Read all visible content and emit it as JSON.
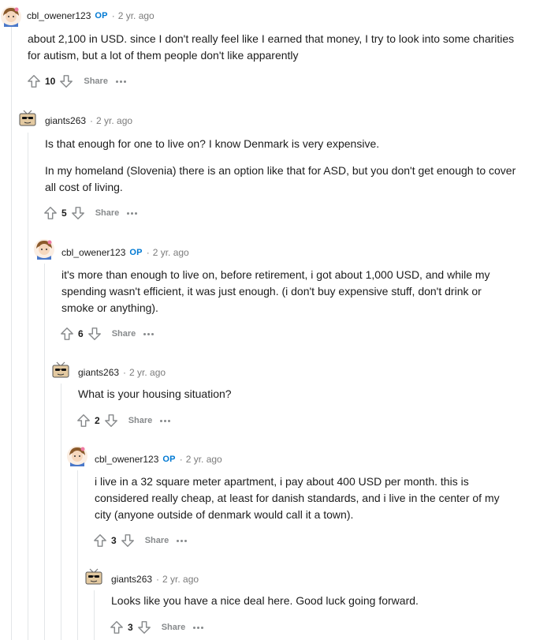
{
  "comments": [
    {
      "author": "cbl_owener123",
      "op": "OP",
      "time": "2 yr. ago",
      "paragraphs": [
        "about 2,100 in USD. since I don't really feel like I earned that money, I try to look into some charities for autism, but a lot of them people don't like apparently"
      ],
      "score": "10",
      "share": "Share",
      "avatar_icon": "girl-avatar-icon"
    },
    {
      "author": "giants263",
      "time": "2 yr. ago",
      "paragraphs": [
        "Is that enough for one to live on? I know Denmark is very expensive.",
        "In my homeland (Slovenia) there is an option like that for ASD, but you don't get enough to cover all cost of living."
      ],
      "score": "5",
      "share": "Share",
      "avatar_icon": "tv-sunglasses-avatar-icon"
    },
    {
      "author": "cbl_owener123",
      "op": "OP",
      "time": "2 yr. ago",
      "paragraphs": [
        "it's more than enough to live on, before retirement, i got about 1,000 USD, and while my spending wasn't efficient, it was just enough. (i don't buy expensive stuff, don't drink or smoke or anything)."
      ],
      "score": "6",
      "share": "Share",
      "avatar_icon": "girl-avatar-icon"
    },
    {
      "author": "giants263",
      "time": "2 yr. ago",
      "paragraphs": [
        "What is your housing situation?"
      ],
      "score": "2",
      "share": "Share",
      "avatar_icon": "tv-sunglasses-avatar-icon"
    },
    {
      "author": "cbl_owener123",
      "op": "OP",
      "time": "2 yr. ago",
      "paragraphs": [
        "i live in a 32 square meter apartment, i pay about 400 USD per month. this is considered really cheap, at least for danish standards, and i live in the center of my city (anyone outside of denmark would call it a town)."
      ],
      "score": "3",
      "share": "Share",
      "avatar_icon": "girl-avatar-icon"
    },
    {
      "author": "giants263",
      "time": "2 yr. ago",
      "paragraphs": [
        "Looks like you have a nice deal here. Good luck going forward."
      ],
      "score": "3",
      "share": "Share",
      "avatar_icon": "tv-sunglasses-avatar-icon"
    }
  ],
  "colors": {
    "op_badge": "#0079d3",
    "meta_text": "#7c7c7c",
    "action_text": "#878a8c",
    "thread_line": "#e3e6e8"
  }
}
